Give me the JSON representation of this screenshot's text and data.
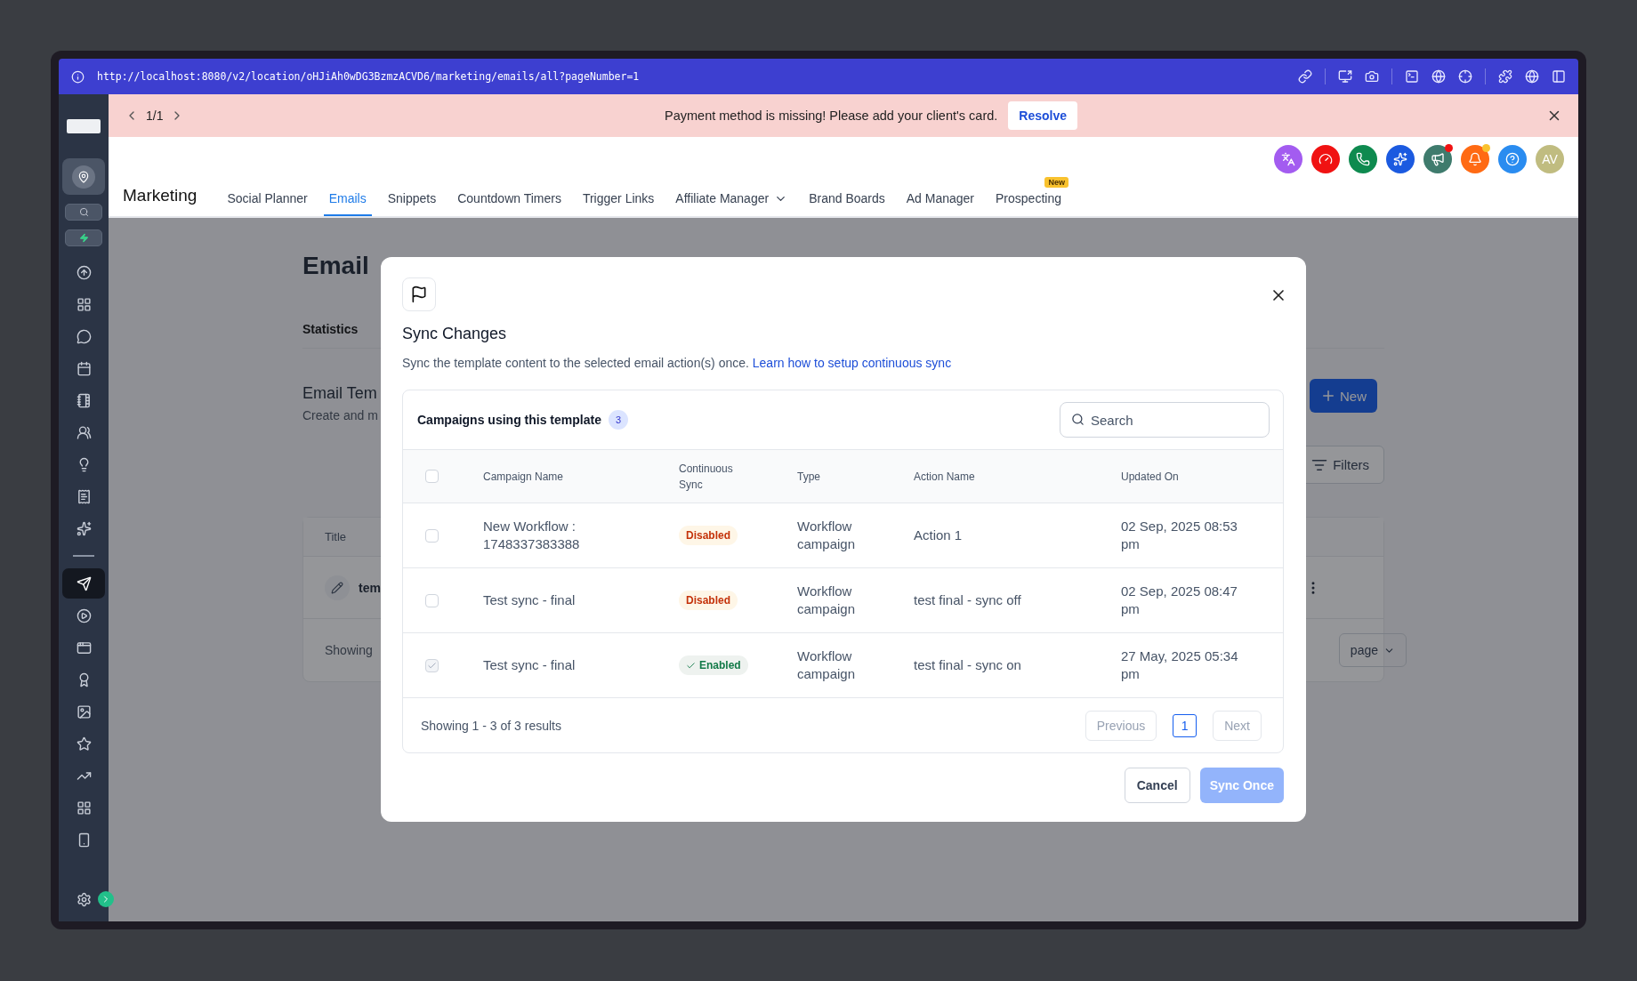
{
  "browser": {
    "url": "http://localhost:8080/v2/location/oHJiAh0wDG3BzmzACVD6/marketing/emails/all?pageNumber=1"
  },
  "sidebar": {
    "items": [
      {
        "selected": false
      },
      {
        "selected": false
      },
      {
        "selected": false
      },
      {
        "selected": false
      },
      {
        "selected": false
      },
      {
        "selected": false
      },
      {
        "selected": false
      },
      {
        "selected": false
      },
      {
        "selected": false
      },
      {
        "selected": true
      },
      {
        "selected": false
      },
      {
        "selected": false
      },
      {
        "selected": false
      },
      {
        "selected": false
      },
      {
        "selected": false
      },
      {
        "selected": false
      },
      {
        "selected": false
      },
      {
        "selected": false
      }
    ]
  },
  "banner": {
    "pager": "1/1",
    "message": "Payment method is missing! Please add your client's card.",
    "action": "Resolve"
  },
  "header": {
    "avatar": "AV",
    "title": "Marketing",
    "tabs": [
      {
        "label": "Social Planner",
        "selected": false
      },
      {
        "label": "Emails",
        "selected": true
      },
      {
        "label": "Snippets",
        "selected": false
      },
      {
        "label": "Countdown Timers",
        "selected": false
      },
      {
        "label": "Trigger Links",
        "selected": false
      },
      {
        "label": "Affiliate Manager",
        "selected": false,
        "dropdown": true
      },
      {
        "label": "Brand Boards",
        "selected": false
      },
      {
        "label": "Ad Manager",
        "selected": false
      },
      {
        "label": "Prospecting",
        "selected": false,
        "badge": "New"
      }
    ]
  },
  "page": {
    "title": "Email",
    "tab": "Statistics",
    "section_title": "Email Tem",
    "section_subtitle": "Create and m",
    "new_button": "New",
    "filters_button": "Filters",
    "table": {
      "column": "Title",
      "row": "tem",
      "footer": "Showing",
      "per_page": "page"
    }
  },
  "modal": {
    "title": "Sync Changes",
    "description": "Sync the template content to the selected email action(s) once.",
    "link": "Learn how to setup continuous sync",
    "card_title": "Campaigns using this template",
    "count": "3",
    "search": {
      "placeholder": "Search"
    },
    "columns": [
      "Campaign Name",
      "Continuous Sync",
      "Type",
      "Action Name",
      "Updated On"
    ],
    "select_all": {
      "checked": false
    },
    "rows": [
      {
        "checked": false,
        "disabled": false,
        "name": "New Workflow : 1748337383388",
        "sync": {
          "label": "Disabled",
          "on": false
        },
        "type": "Workflow campaign",
        "action": "Action 1",
        "updated": "02 Sep, 2025 08:53 pm"
      },
      {
        "checked": false,
        "disabled": false,
        "name": "Test sync - final",
        "sync": {
          "label": "Disabled",
          "on": false
        },
        "type": "Workflow campaign",
        "action": "test final - sync off",
        "updated": "02 Sep, 2025 08:47 pm"
      },
      {
        "checked": true,
        "disabled": true,
        "name": "Test sync - final",
        "sync": {
          "label": "Enabled",
          "on": true
        },
        "type": "Workflow campaign",
        "action": "test final - sync on",
        "updated": "27 May, 2025 05:34 pm"
      }
    ],
    "summary": "Showing 1 - 3 of 3 results",
    "pagination": {
      "previous": {
        "label": "Previous",
        "disabled": true
      },
      "pages": [
        {
          "label": "1",
          "selected": true
        }
      ],
      "next": {
        "label": "Next",
        "disabled": true
      }
    },
    "cancel": "Cancel",
    "confirm": {
      "label": "Sync Once",
      "disabled": true
    }
  }
}
